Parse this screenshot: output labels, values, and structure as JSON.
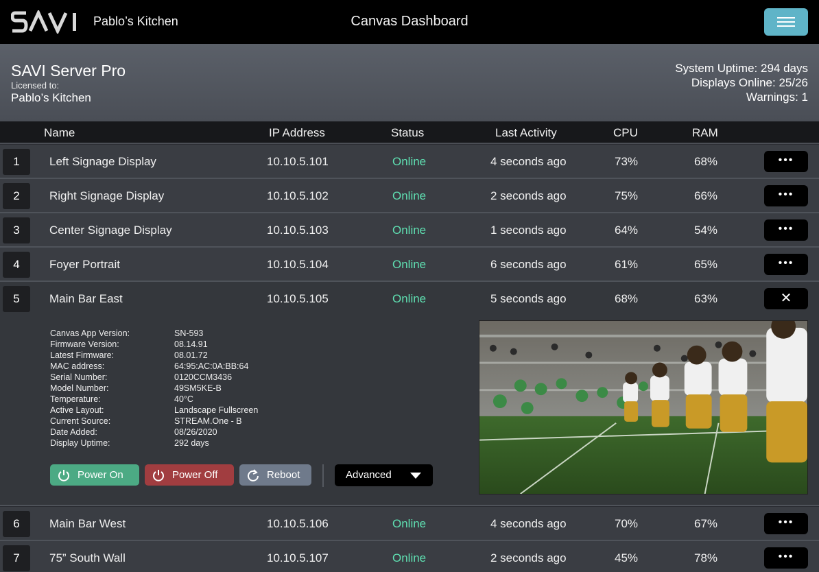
{
  "header": {
    "logo_text": "SAVI",
    "site_name": "Pablo’s Kitchen",
    "title": "Canvas Dashboard",
    "menu_icon": "hamburger-icon"
  },
  "summary": {
    "server_name": "SAVI Server Pro",
    "licensed_to_label": "Licensed to:",
    "licensee": "Pablo’s Kitchen",
    "uptime": "System Uptime: 294 days",
    "displays_online": "Displays Online: 25/26",
    "warnings": "Warnings: 1"
  },
  "table": {
    "columns": [
      "Name",
      "IP Address",
      "Status",
      "Last Activity",
      "CPU",
      "RAM"
    ],
    "rows": [
      {
        "num": "1",
        "name": "Left Signage Display",
        "ip": "10.10.5.101",
        "status": "Online",
        "activity": "4 seconds ago",
        "cpu": "73%",
        "ram": "68%",
        "action": "•••"
      },
      {
        "num": "2",
        "name": "Right Signage Display",
        "ip": "10.10.5.102",
        "status": "Online",
        "activity": "2 seconds ago",
        "cpu": "75%",
        "ram": "66%",
        "action": "•••"
      },
      {
        "num": "3",
        "name": "Center Signage Display",
        "ip": "10.10.5.103",
        "status": "Online",
        "activity": "1 seconds ago",
        "cpu": "64%",
        "ram": "54%",
        "action": "•••"
      },
      {
        "num": "4",
        "name": "Foyer Portrait",
        "ip": "10.10.5.104",
        "status": "Online",
        "activity": "6 seconds ago",
        "cpu": "61%",
        "ram": "65%",
        "action": "•••"
      },
      {
        "num": "5",
        "name": "Main Bar East",
        "ip": "10.10.5.105",
        "status": "Online",
        "activity": "5 seconds ago",
        "cpu": "68%",
        "ram": "63%",
        "action": "✕"
      },
      {
        "num": "6",
        "name": "Main Bar West",
        "ip": "10.10.5.106",
        "status": "Online",
        "activity": "4 seconds ago",
        "cpu": "70%",
        "ram": "67%",
        "action": "•••"
      },
      {
        "num": "7",
        "name": "75” South Wall",
        "ip": "10.10.5.107",
        "status": "Online",
        "activity": "2 seconds ago",
        "cpu": "45%",
        "ram": "78%",
        "action": "•••"
      }
    ]
  },
  "details": {
    "labels": [
      "Canvas App Version:",
      "Firmware Version:",
      "Latest Firmware:",
      "MAC address:",
      "Serial Number:",
      "Model Number:",
      "Temperature:",
      "Active Layout:",
      "Current Source:",
      "Date Added:",
      "Display Uptime:"
    ],
    "values": [
      "SN-593",
      "08.14.91",
      "08.01.72",
      "64:95:AC:0A:BB:64",
      "0120CCM3436",
      "49SM5KE-B",
      "40°C",
      "Landscape Fullscreen",
      "STREAM.One - B",
      "08/26/2020",
      "292 days"
    ],
    "buttons": {
      "power_on": "Power On",
      "power_off": "Power Off",
      "reboot": "Reboot",
      "advanced": "Advanced"
    },
    "colors": {
      "power_on": "#4caa84",
      "power_off": "#a13d40",
      "reboot": "#6f7a8b",
      "status_online": "#5fe0b2",
      "menu_button": "#5fb4c8"
    }
  }
}
